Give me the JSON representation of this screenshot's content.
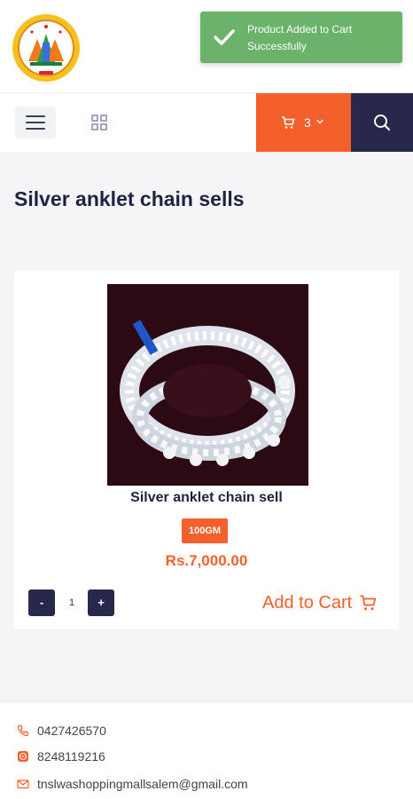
{
  "toast": {
    "message": "Product Added to Cart Successfully"
  },
  "header": {
    "logo_icon": "state-emblem-logo"
  },
  "navbar": {
    "menu_icon": "hamburger-icon",
    "grid_icon": "grid-icon",
    "cart_count": "3",
    "search_icon": "search-icon"
  },
  "page": {
    "title": "Silver anklet chain sells"
  },
  "product": {
    "name": "Silver anklet chain sell",
    "weight": "100GM",
    "price": "Rs.7,000.00",
    "quantity": "1",
    "minus_label": "-",
    "plus_label": "+",
    "add_to_cart_label": "Add to Cart"
  },
  "footer": {
    "phone": "0427426570",
    "mobile": "8248119216",
    "email": "tnslwashoppingmallsalem@gmail.com"
  },
  "colors": {
    "accent": "#f4602b",
    "navy": "#27284b",
    "toast": "#6bb26b"
  }
}
